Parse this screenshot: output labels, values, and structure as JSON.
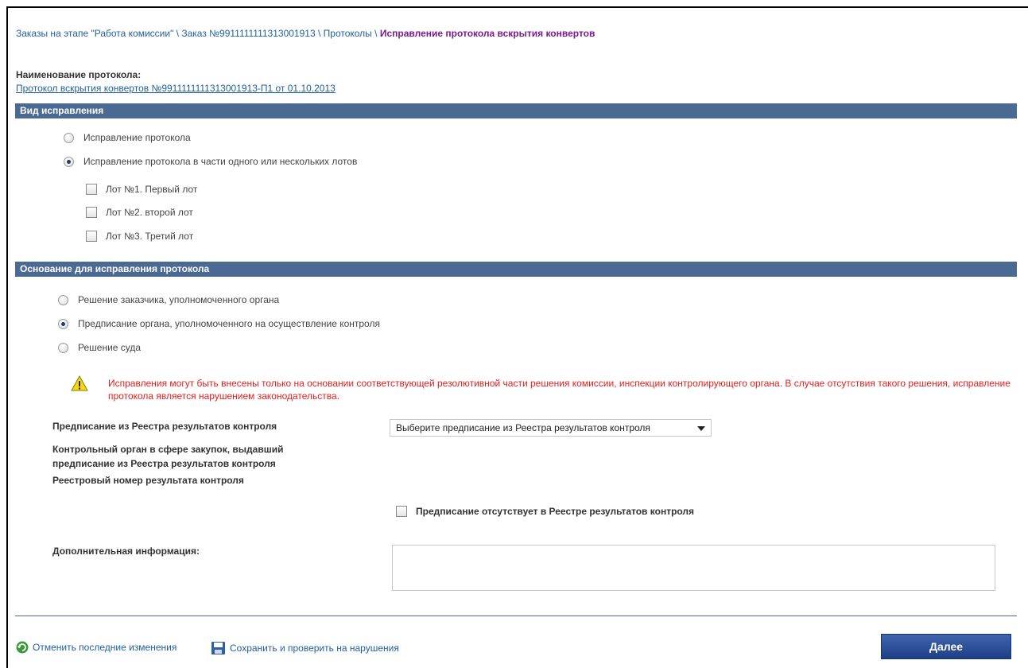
{
  "breadcrumb": {
    "item1": "Заказы на этапе \"Работа комиссии\"",
    "item2": "Заказ №9911111111313001913",
    "item3": "Протоколы",
    "current": "Исправление протокола вскрытия конвертов",
    "separator": " \\ "
  },
  "protocol": {
    "label": "Наименование протокола:",
    "link": "Протокол вскрытия конвертов №9911111111313001913-П1 от 01.10.2013"
  },
  "correction_type": {
    "title": "Вид исправления",
    "options": [
      {
        "label": "Исправление протокола",
        "selected": false
      },
      {
        "label": "Исправление протокола в части одного или нескольких лотов",
        "selected": true
      }
    ],
    "lots": [
      {
        "label": "Лот №1. Первый лот",
        "checked": false
      },
      {
        "label": "Лот №2. второй лот",
        "checked": false
      },
      {
        "label": "Лот №3. Третий лот",
        "checked": false
      }
    ]
  },
  "basis": {
    "title": "Основание для исправления протокола",
    "options": [
      {
        "label": "Решение заказчика, уполномоченного органа",
        "selected": false
      },
      {
        "label": "Предписание органа, уполномоченного на осуществление контроля",
        "selected": true
      },
      {
        "label": "Решение суда",
        "selected": false
      }
    ]
  },
  "warning": {
    "icon": "warning-icon",
    "text": "Исправления могут быть внесены только на основании соответствующей резолютивной части решения комиссии, инспекции контролирующего органа. В случае отсутствия такого решения, исправление протокола является нарушением законодательства."
  },
  "form": {
    "prescription_label": "Предписание из Реестра результатов контроля",
    "prescription_select": "Выберите предписание из Реестра результатов контроля",
    "control_body_label_line1": "Контрольный орган в сфере закупок, выдавший",
    "control_body_label_line2": "предписание из Реестра результатов контроля",
    "registry_number_label": "Реестровый номер результата контроля",
    "absent_checkbox_label": "Предписание отсутствует в Реестре результатов контроля",
    "additional_info_label": "Дополнительная информация:",
    "additional_info_value": ""
  },
  "actions": {
    "undo": "Отменить последние изменения",
    "save": "Сохранить и проверить на нарушения",
    "next": "Далее"
  },
  "colors": {
    "section_bar": "#4a6a94",
    "link": "#1f5f9f",
    "current_breadcrumb": "#7a1a8e",
    "warning_text": "#e02020",
    "next_button": "#2a4f9a"
  }
}
